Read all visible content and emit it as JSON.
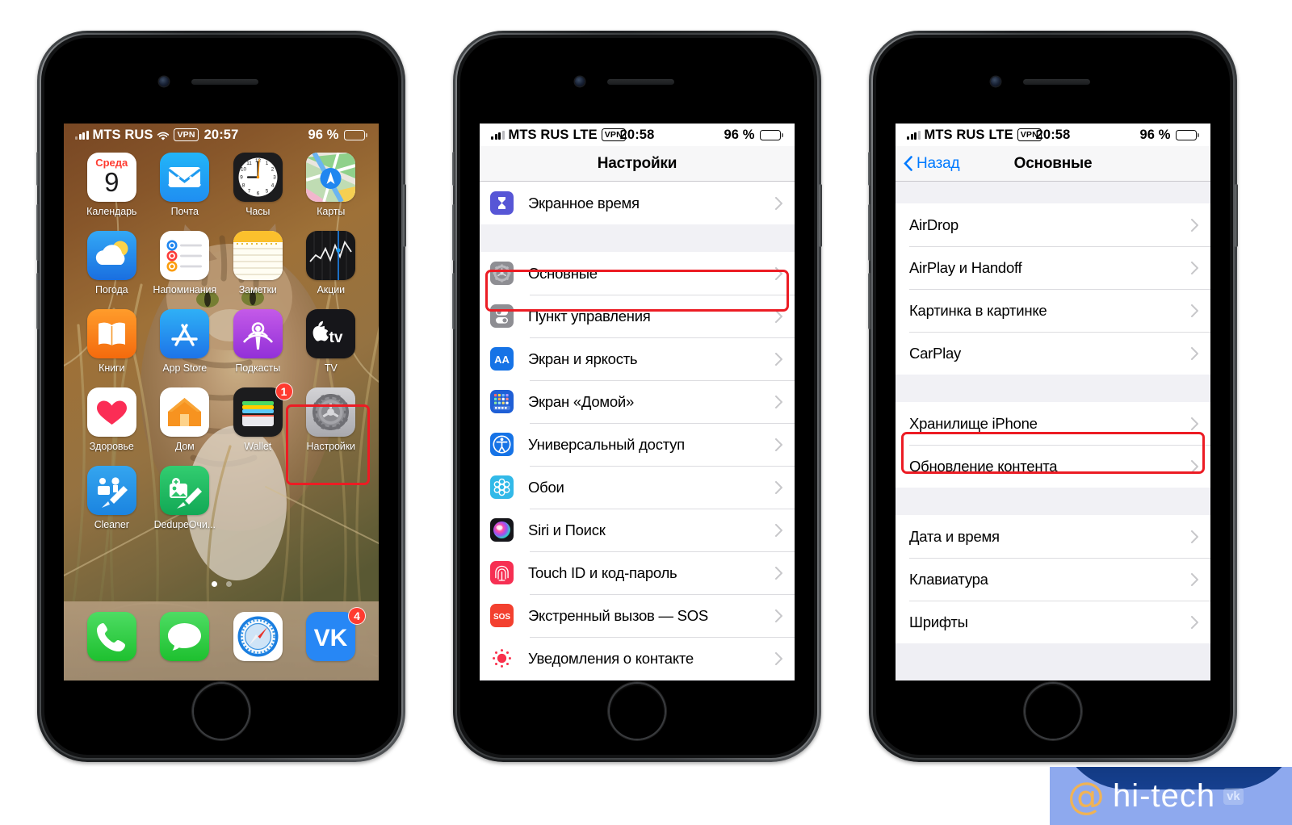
{
  "colors": {
    "accent_blue": "#007aff",
    "highlight_red": "#ec1c24",
    "badge_red": "#ff3b30",
    "list_bg": "#efeff4",
    "navbar_bg": "#f7f7f8"
  },
  "phones": [
    {
      "id": "phone-home-screen",
      "status_bar": {
        "carrier": "MTS RUS",
        "network": "",
        "wifi_icon": "wifi-icon",
        "vpn_badge": "VPN",
        "time": "20:57",
        "battery_percent": "96 %",
        "battery_icon": "battery-icon"
      },
      "home_screen": {
        "rows": [
          [
            {
              "label": "Календарь",
              "icon": "calendar-icon",
              "weekday": "Среда",
              "day": "9"
            },
            {
              "label": "Почта",
              "icon": "mail-icon"
            },
            {
              "label": "Часы",
              "icon": "clock-icon"
            },
            {
              "label": "Карты",
              "icon": "maps-icon"
            }
          ],
          [
            {
              "label": "Погода",
              "icon": "weather-icon"
            },
            {
              "label": "Напоминания",
              "icon": "reminders-icon"
            },
            {
              "label": "Заметки",
              "icon": "notes-icon"
            },
            {
              "label": "Акции",
              "icon": "stocks-icon"
            }
          ],
          [
            {
              "label": "Книги",
              "icon": "books-icon"
            },
            {
              "label": "App Store",
              "icon": "appstore-icon"
            },
            {
              "label": "Подкасты",
              "icon": "podcasts-icon"
            },
            {
              "label": "TV",
              "icon": "appletv-icon"
            }
          ],
          [
            {
              "label": "Здоровье",
              "icon": "health-icon"
            },
            {
              "label": "Дом",
              "icon": "home-icon"
            },
            {
              "label": "Wallet",
              "icon": "wallet-icon",
              "badge": "1"
            },
            {
              "label": "Настройки",
              "icon": "settings-gear-icon",
              "highlighted": true
            }
          ],
          [
            {
              "label": "Cleaner",
              "icon": "cleaner-icon"
            },
            {
              "label": "DedupeОчи...",
              "icon": "dedupe-icon"
            }
          ]
        ],
        "page_dots": {
          "count": 2,
          "active": 0
        },
        "dock": [
          {
            "label": "",
            "icon": "phone-icon"
          },
          {
            "label": "",
            "icon": "messages-icon"
          },
          {
            "label": "",
            "icon": "safari-icon"
          },
          {
            "label": "",
            "icon": "vk-icon",
            "badge": "4"
          }
        ]
      }
    },
    {
      "id": "phone-settings",
      "status_bar": {
        "carrier": "MTS RUS",
        "network": "LTE",
        "vpn_badge": "VPN",
        "time": "20:58",
        "battery_percent": "96 %",
        "battery_icon": "battery-icon"
      },
      "navbar": {
        "title": "Настройки"
      },
      "sections": [
        {
          "items": [
            {
              "label": "Экранное время",
              "icon": "screentime-icon"
            }
          ]
        },
        {
          "items": [
            {
              "label": "Основные",
              "icon": "general-gear-icon",
              "highlighted": true
            },
            {
              "label": "Пункт управления",
              "icon": "control-center-icon"
            },
            {
              "label": "Экран и яркость",
              "icon": "display-brightness-icon"
            },
            {
              "label": "Экран «Домой»",
              "icon": "home-screen-icon"
            },
            {
              "label": "Универсальный доступ",
              "icon": "accessibility-icon"
            },
            {
              "label": "Обои",
              "icon": "wallpaper-icon"
            },
            {
              "label": "Siri и Поиск",
              "icon": "siri-icon"
            },
            {
              "label": "Touch ID и код-пароль",
              "icon": "touchid-icon"
            },
            {
              "label": "Экстренный вызов — SOS",
              "icon": "sos-icon"
            },
            {
              "label": "Уведомления о контакте",
              "icon": "exposure-notifications-icon"
            }
          ]
        }
      ]
    },
    {
      "id": "phone-general",
      "status_bar": {
        "carrier": "MTS RUS",
        "network": "LTE",
        "vpn_badge": "VPN",
        "time": "20:58",
        "battery_percent": "96 %",
        "battery_icon": "battery-icon"
      },
      "navbar": {
        "back_label": "Назад",
        "back_icon": "chevron-left-icon",
        "title": "Основные"
      },
      "sections": [
        {
          "items": [
            {
              "label": "AirDrop"
            },
            {
              "label": "AirPlay и Handoff"
            },
            {
              "label": "Картинка в картинке"
            },
            {
              "label": "CarPlay"
            }
          ]
        },
        {
          "items": [
            {
              "label": "Хранилище iPhone",
              "highlighted": true
            },
            {
              "label": "Обновление контента"
            }
          ]
        },
        {
          "items": [
            {
              "label": "Дата и время"
            },
            {
              "label": "Клавиатура"
            },
            {
              "label": "Шрифты"
            }
          ]
        }
      ]
    }
  ],
  "watermark": {
    "at_symbol": "@",
    "text": "hi-tech",
    "vk_badge": "vk"
  }
}
